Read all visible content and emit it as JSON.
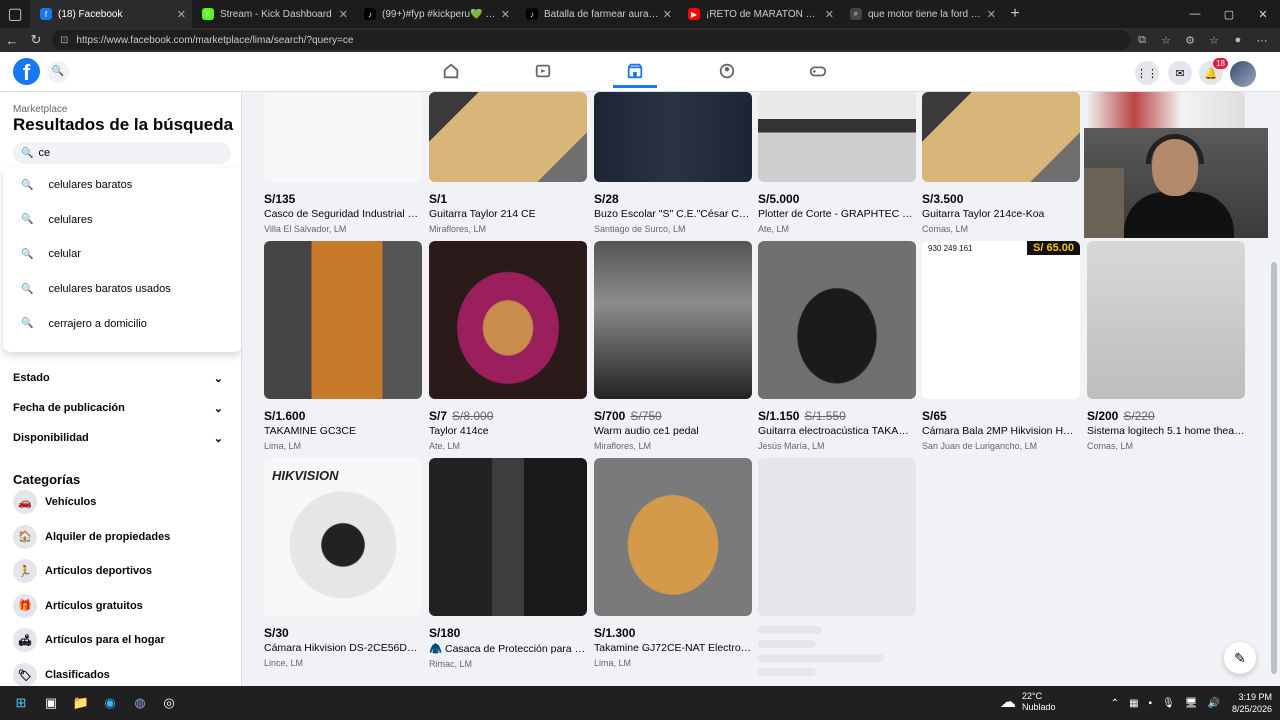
{
  "browser": {
    "tabs": [
      {
        "title": "(18) Facebook",
        "fav": "f",
        "color": "#1877f2"
      },
      {
        "title": "Stream - Kick Dashboard",
        "fav": "K",
        "color": "#53fc18"
      },
      {
        "title": "(99+)#fyp #kickperu💚 #sideral #",
        "fav": "♪",
        "color": "#000"
      },
      {
        "title": "Batalla de farmear aura Intenta fa",
        "fav": "♪",
        "color": "#000"
      },
      {
        "title": "¡RETO de MARATÓN 21K! 🏃 5",
        "fav": "▶",
        "color": "#ff0000"
      },
      {
        "title": "que motor tiene la ford raptor - S",
        "fav": "⌕",
        "color": "#444"
      }
    ],
    "url": "https://www.facebook.com/marketplace/lima/search/?query=ce"
  },
  "header": {
    "notif_count": "18"
  },
  "sidebar": {
    "section": "Marketplace",
    "title": "Resultados de la búsqueda",
    "search_value": "ce",
    "suggestions": [
      "celulares baratos",
      "celulares",
      "celular",
      "celulares baratos usados",
      "cerrajero a domicilio"
    ],
    "filters": [
      "Estado",
      "Fecha de publicación",
      "Disponibilidad"
    ],
    "categories_title": "Categorías",
    "categories": [
      {
        "label": "Vehículos",
        "icon": "car-icon",
        "glyph": "🚗"
      },
      {
        "label": "Alquiler de propiedades",
        "icon": "house-icon",
        "glyph": "🏠"
      },
      {
        "label": "Artículos deportivos",
        "icon": "running-icon",
        "glyph": "🏃"
      },
      {
        "label": "Artículos gratuitos",
        "icon": "gift-icon",
        "glyph": "🎁"
      },
      {
        "label": "Artículos para el hogar",
        "icon": "home-goods-icon",
        "glyph": "🛋"
      },
      {
        "label": "Clasificados",
        "icon": "tag-icon",
        "glyph": "🏷"
      }
    ]
  },
  "listings": [
    {
      "price": "S/135",
      "old": "",
      "title": "Casco de Seguridad Industrial EN3...",
      "loc": "Villa El Salvador, LM",
      "img": "helmet"
    },
    {
      "price": "S/1",
      "old": "",
      "title": "Guitarra Taylor 214 CE",
      "loc": "Miraflores, LM",
      "img": "guitar"
    },
    {
      "price": "S/28",
      "old": "",
      "title": "Buzo Escolar \"S\" C.E.\"César Carbo...",
      "loc": "Santiago de Surco, LM",
      "img": "jacket"
    },
    {
      "price": "S/5.000",
      "old": "",
      "title": "Plotter de Corte - GRAPHTEC CE 7...",
      "loc": "Ate, LM",
      "img": "plotter"
    },
    {
      "price": "S/3.500",
      "old": "",
      "title": "Guitarra Taylor 214ce-Koa",
      "loc": "Comas, LM",
      "img": "guitar"
    },
    {
      "price": "",
      "old": "",
      "title": "",
      "loc": "",
      "img": "shirts"
    },
    {
      "price": "S/1.600",
      "old": "",
      "title": "TAKAMINE GC3CE",
      "loc": "Lima, LM",
      "img": "guitar2"
    },
    {
      "price": "S/7",
      "old": "S/8.000",
      "title": "Taylor 414ce",
      "loc": "Ate, LM",
      "img": "case"
    },
    {
      "price": "S/700",
      "old": "S/750",
      "title": "Warm audio ce1 pedal",
      "loc": "Miraflores, LM",
      "img": "pedal"
    },
    {
      "price": "S/1.150",
      "old": "S/1.550",
      "title": "Guitarra electroacústica TAKAMIN...",
      "loc": "Jesús María, LM",
      "img": "blackguitar"
    },
    {
      "price": "S/65",
      "old": "",
      "title": "Cámara Bala 2MP Hikvision HK-D...",
      "loc": "San Juan de Lurigancho, LM",
      "img": "bullet",
      "promo": "S/ 65.00",
      "phone": "930 249 161"
    },
    {
      "price": "S/200",
      "old": "S/220",
      "title": "Sistema logitech 5.1 home theater...",
      "loc": "Comas, LM",
      "img": "speakers"
    },
    {
      "price": "S/30",
      "old": "",
      "title": "Cámara Hikvision DS-2CE56D0T-I...",
      "loc": "Lince, LM",
      "img": "dome",
      "brand": "HIKVISION"
    },
    {
      "price": "S/180",
      "old": "",
      "title": "🧥 Casaca de Protección para Mo...",
      "loc": "Rimac, LM",
      "img": "moto"
    },
    {
      "price": "S/1.300",
      "old": "",
      "title": "Takamine GJ72CE-NAT Electroacús...",
      "loc": "Lima, LM",
      "img": "guitar3"
    }
  ],
  "taskbar": {
    "temp": "22°C",
    "weather": "Nublado",
    "time": "3:19 PM",
    "date": "8/25/2026"
  }
}
